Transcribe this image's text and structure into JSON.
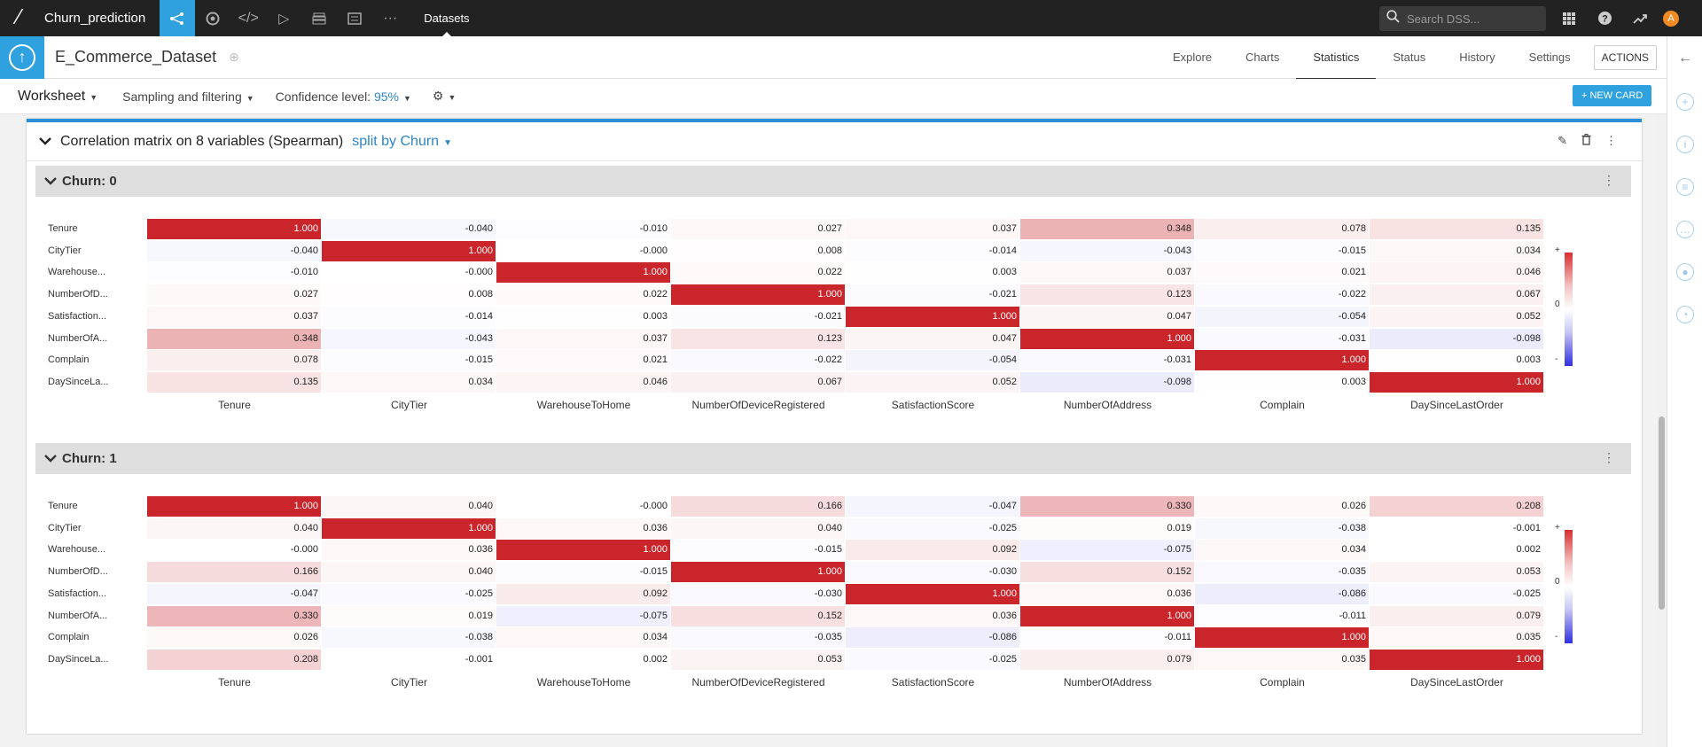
{
  "topnav": {
    "project_name": "Churn_prediction",
    "datasets_label": "Datasets",
    "search_placeholder": "Search DSS...",
    "avatar_letter": "A"
  },
  "dataset": {
    "name": "E_Commerce_Dataset",
    "tabs": [
      "Explore",
      "Charts",
      "Statistics",
      "Status",
      "History",
      "Settings"
    ],
    "active_tab": "Statistics",
    "actions_label": "ACTIONS"
  },
  "worksheet": {
    "title": "Worksheet",
    "sampling_label": "Sampling and filtering",
    "confidence_label": "Confidence level:",
    "confidence_value": "95%",
    "new_card_label": "+ NEW CARD"
  },
  "card": {
    "title": "Correlation matrix on 8 variables (Spearman)",
    "split_label": "split by Churn",
    "row_labels": [
      "Tenure",
      "CityTier",
      "Warehouse...",
      "NumberOfD...",
      "Satisfaction...",
      "NumberOfA...",
      "Complain",
      "DaySinceLa..."
    ],
    "col_labels": [
      "Tenure",
      "CityTier",
      "WarehouseToHome",
      "NumberOfDeviceRegistered",
      "SatisfactionScore",
      "NumberOfAddress",
      "Complain",
      "DaySinceLastOrder"
    ],
    "legend": {
      "plus": "+",
      "zero": "0",
      "minus": "-"
    },
    "groups": [
      {
        "title": "Churn: 0",
        "matrix": [
          [
            "1.000",
            "-0.040",
            "-0.010",
            "0.027",
            "0.037",
            "0.348",
            "0.078",
            "0.135"
          ],
          [
            "-0.040",
            "1.000",
            "-0.000",
            "0.008",
            "-0.014",
            "-0.043",
            "-0.015",
            "0.034"
          ],
          [
            "-0.010",
            "-0.000",
            "1.000",
            "0.022",
            "0.003",
            "0.037",
            "0.021",
            "0.046"
          ],
          [
            "0.027",
            "0.008",
            "0.022",
            "1.000",
            "-0.021",
            "0.123",
            "-0.022",
            "0.067"
          ],
          [
            "0.037",
            "-0.014",
            "0.003",
            "-0.021",
            "1.000",
            "0.047",
            "-0.054",
            "0.052"
          ],
          [
            "0.348",
            "-0.043",
            "0.037",
            "0.123",
            "0.047",
            "1.000",
            "-0.031",
            "-0.098"
          ],
          [
            "0.078",
            "-0.015",
            "0.021",
            "-0.022",
            "-0.054",
            "-0.031",
            "1.000",
            "0.003"
          ],
          [
            "0.135",
            "0.034",
            "0.046",
            "0.067",
            "0.052",
            "-0.098",
            "0.003",
            "1.000"
          ]
        ]
      },
      {
        "title": "Churn: 1",
        "matrix": [
          [
            "1.000",
            "0.040",
            "-0.000",
            "0.166",
            "-0.047",
            "0.330",
            "0.026",
            "0.208"
          ],
          [
            "0.040",
            "1.000",
            "0.036",
            "0.040",
            "-0.025",
            "0.019",
            "-0.038",
            "-0.001"
          ],
          [
            "-0.000",
            "0.036",
            "1.000",
            "-0.015",
            "0.092",
            "-0.075",
            "0.034",
            "0.002"
          ],
          [
            "0.166",
            "0.040",
            "-0.015",
            "1.000",
            "-0.030",
            "0.152",
            "-0.035",
            "0.053"
          ],
          [
            "-0.047",
            "-0.025",
            "0.092",
            "-0.030",
            "1.000",
            "0.036",
            "-0.086",
            "-0.025"
          ],
          [
            "0.330",
            "0.019",
            "-0.075",
            "0.152",
            "0.036",
            "1.000",
            "-0.011",
            "0.079"
          ],
          [
            "0.026",
            "-0.038",
            "0.034",
            "-0.035",
            "-0.086",
            "-0.011",
            "1.000",
            "0.035"
          ],
          [
            "0.208",
            "-0.001",
            "0.002",
            "0.053",
            "-0.025",
            "0.079",
            "0.035",
            "1.000"
          ]
        ]
      }
    ]
  },
  "colors": {
    "accent": "#2ea1de",
    "positive": "#c9252b",
    "negative": "#2f2fe0"
  }
}
